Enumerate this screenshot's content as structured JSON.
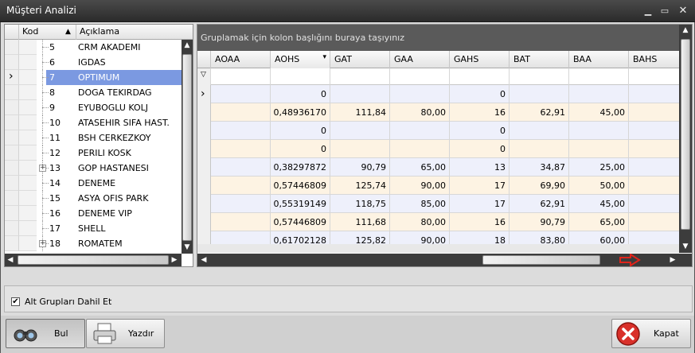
{
  "window": {
    "title": "Müşteri Analizi"
  },
  "tree": {
    "columns": {
      "kod": "Kod",
      "aciklama": "Açıklama"
    },
    "rows": [
      {
        "kod": "5",
        "name": "CRM AKADEMI",
        "selected": false,
        "expandable": false
      },
      {
        "kod": "6",
        "name": "IGDAS",
        "selected": false,
        "expandable": false
      },
      {
        "kod": "7",
        "name": "OPTIMUM",
        "selected": true,
        "expandable": false
      },
      {
        "kod": "8",
        "name": "DOGA TEKIRDAG",
        "selected": false,
        "expandable": false
      },
      {
        "kod": "9",
        "name": "EYUBOGLU KOLJ",
        "selected": false,
        "expandable": false
      },
      {
        "kod": "10",
        "name": "ATASEHIR SIFA HAST.",
        "selected": false,
        "expandable": false
      },
      {
        "kod": "11",
        "name": "BSH CERKEZKOY",
        "selected": false,
        "expandable": false
      },
      {
        "kod": "12",
        "name": "PERILI KOSK",
        "selected": false,
        "expandable": false
      },
      {
        "kod": "13",
        "name": "GOP HASTANESI",
        "selected": false,
        "expandable": true
      },
      {
        "kod": "14",
        "name": "DENEME",
        "selected": false,
        "expandable": false
      },
      {
        "kod": "15",
        "name": "ASYA OFIS PARK",
        "selected": false,
        "expandable": false
      },
      {
        "kod": "16",
        "name": "DENEME VIP",
        "selected": false,
        "expandable": false
      },
      {
        "kod": "17",
        "name": "SHELL",
        "selected": false,
        "expandable": false
      },
      {
        "kod": "18",
        "name": "ROMATEM",
        "selected": false,
        "expandable": true
      }
    ]
  },
  "grid": {
    "group_hint": "Gruplamak için kolon başlığını buraya taşıyınız",
    "columns": [
      "AOAA",
      "AOHS",
      "GAT",
      "GAA",
      "GAHS",
      "BAT",
      "BAA",
      "BAHS"
    ],
    "rows": [
      [
        "",
        "0",
        "",
        "",
        "0",
        "",
        "",
        ""
      ],
      [
        "",
        "0,48936170",
        "111,84",
        "80,00",
        "16",
        "62,91",
        "45,00",
        ""
      ],
      [
        "",
        "0",
        "",
        "",
        "0",
        "",
        "",
        ""
      ],
      [
        "",
        "0",
        "",
        "",
        "0",
        "",
        "",
        ""
      ],
      [
        "",
        "0,38297872",
        "90,79",
        "65,00",
        "13",
        "34,87",
        "25,00",
        ""
      ],
      [
        "",
        "0,57446809",
        "125,74",
        "90,00",
        "17",
        "69,90",
        "50,00",
        ""
      ],
      [
        "",
        "0,55319149",
        "118,75",
        "85,00",
        "17",
        "62,91",
        "45,00",
        ""
      ],
      [
        "",
        "0,57446809",
        "111,68",
        "80,00",
        "16",
        "90,79",
        "65,00",
        ""
      ],
      [
        "",
        "0,61702128",
        "125,82",
        "90,00",
        "18",
        "83,80",
        "60,00",
        ""
      ]
    ]
  },
  "options": {
    "include_subgroups_label": "Alt Grupları Dahil Et",
    "include_subgroups_checked": true
  },
  "buttons": {
    "find": "Bul",
    "print": "Yazdır",
    "close": "Kapat"
  },
  "colors": {
    "selection": "#7b99e1",
    "row_even": "#eef0fb",
    "row_odd": "#fdf3e3",
    "close_icon": "#d9302a",
    "arrow": "#e0241b"
  }
}
